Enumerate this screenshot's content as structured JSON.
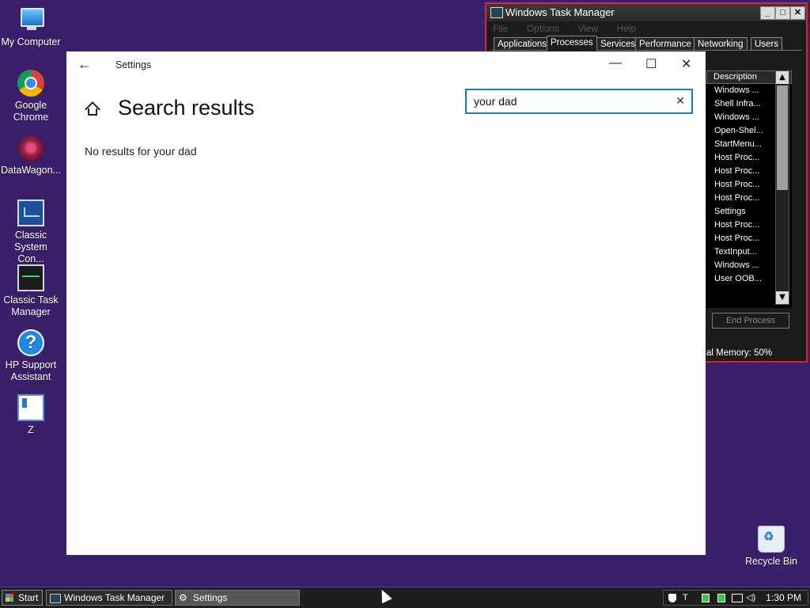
{
  "desktop": {
    "background_color": "#3a1f6b",
    "icons": [
      {
        "label": "My Computer",
        "icon": "computer-icon"
      },
      {
        "label": "Google Chrome",
        "icon": "chrome-icon"
      },
      {
        "label": "DataWagon...",
        "icon": "datawagon-icon"
      },
      {
        "label": "Classic System Con...",
        "icon": "control-panel-icon"
      },
      {
        "label": "Classic Task Manager",
        "icon": "task-manager-icon"
      },
      {
        "label": "HP Support Assistant",
        "icon": "help-icon"
      },
      {
        "label": "Z",
        "icon": "document-icon"
      },
      {
        "label": "Recycle Bin",
        "icon": "recycle-bin-icon"
      }
    ]
  },
  "task_manager": {
    "title": "Windows Task Manager",
    "menu": [
      "File",
      "Options",
      "View",
      "Help"
    ],
    "tabs": [
      "Applications",
      "Processes",
      "Services",
      "Performance",
      "Networking",
      "Users"
    ],
    "active_tab": "Processes",
    "column_header": "Description",
    "rows": [
      "Windows ...",
      "Shell Infra...",
      "Windows ...",
      "Open-Shel...",
      "StartMenu...",
      "Host Proc...",
      "Host Proc...",
      "Host Proc...",
      "Host Proc...",
      "Settings",
      "Host Proc...",
      "Host Proc...",
      "TextInput...",
      "Windows ...",
      "User OOB..."
    ],
    "end_process_label": "End Process",
    "status": "al Memory: 50%",
    "border_color": "#d8262b"
  },
  "settings": {
    "app_title": "Settings",
    "heading": "Search results",
    "search_value": "your dad",
    "no_results_text": "No results for your dad",
    "accent_color": "#1979ca"
  },
  "taskbar": {
    "start_label": "Start",
    "tasks": [
      {
        "label": "Windows Task Manager",
        "active": false
      },
      {
        "label": "Settings",
        "active": true
      }
    ],
    "clock": "1:30 PM"
  }
}
